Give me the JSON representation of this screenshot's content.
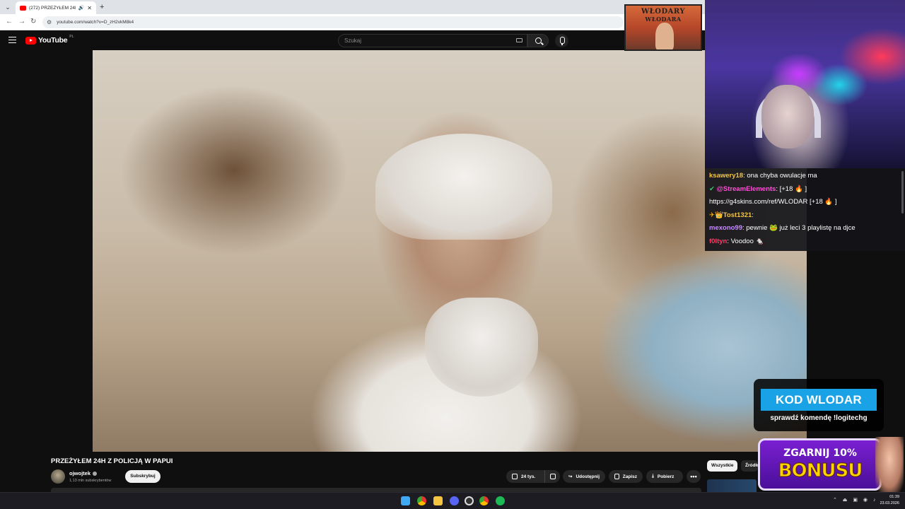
{
  "browser": {
    "tab_title": "(272) PRZEŻYŁEM 24H Z P...",
    "url": "youtube.com/watch?v=D_zH2vkM8k4"
  },
  "youtube": {
    "logo_text": "YouTube",
    "country": "PL",
    "search_placeholder": "Szukaj"
  },
  "video": {
    "title": "PRZEŻYŁEM 24H Z POLICJĄ W PAPUI",
    "channel": "ojwojtek",
    "subscribers": "1,13 mln subskrybentów",
    "subscribe_label": "Subskrybuj",
    "likes": "24 tys.",
    "share_label": "Udostępnij",
    "save_label": "Zapisz",
    "download_label": "Pobierz",
    "more_label": "•••"
  },
  "sidebar": {
    "chips": [
      "Wszystkie",
      "Źródło"
    ]
  },
  "overlay": {
    "banner_top": "WŁODARY",
    "banner_bottom": "WŁODARA",
    "chat": [
      {
        "user": "ksawery18",
        "color": "#f5c542",
        "text": ": ona chyba owulacje ma"
      },
      {
        "user": "@StreamElements",
        "color": "#ff4fd8",
        "prefix": "✔ ",
        "text": ": [+18 🔥 ]"
      },
      {
        "user": "",
        "color": "#ffffff",
        "text": "https://g4skins.com/ref/WLODAR [+18 🔥 ]"
      },
      {
        "user": "Tost1321",
        "color": "#f5c542",
        "prefix": "✈👑",
        "text": ":"
      },
      {
        "user": "mexono99",
        "color": "#c58cff",
        "text": ": pewnie 🐸 już leci 3 playlistę na djce"
      },
      {
        "user": "f0ltyn",
        "color": "#ff3a6a",
        "text": ": Voodoo 🐁"
      }
    ],
    "kod_title": "KOD WLODAR",
    "kod_sub": "sprawdź komendę !logitechg",
    "bonus_line1": "ZGARNIJ 10%",
    "bonus_line2": "BONUSU"
  },
  "taskbar": {
    "time": "01:39",
    "date": "23.03.2026"
  }
}
